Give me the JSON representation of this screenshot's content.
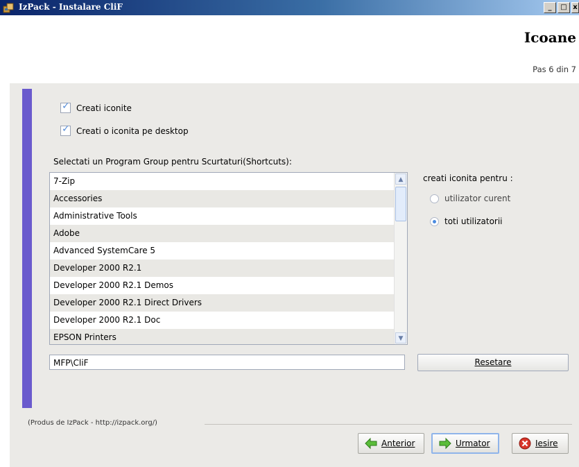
{
  "window": {
    "title": "IzPack - Instalare CliF",
    "buttons": {
      "minimize": "_",
      "maximize": "□",
      "close": "x"
    }
  },
  "header": {
    "heading": "Icoane",
    "step": "Pas 6 din 7"
  },
  "options": {
    "create_icons": {
      "label": "Creati iconite",
      "checked": true
    },
    "create_desktop_icon": {
      "label": "Creati o iconita pe desktop",
      "checked": true
    }
  },
  "program_group": {
    "label": "Selectati un Program Group pentru Scurtaturi(Shortcuts):",
    "items": [
      "7-Zip",
      "Accessories",
      "Administrative Tools",
      "Adobe",
      "Advanced SystemCare 5",
      "Developer 2000 R2.1",
      "Developer 2000 R2.1 Demos",
      "Developer 2000 R2.1 Direct Drivers",
      "Developer 2000 R2.1 Doc",
      "EPSON Printers"
    ],
    "path_value": "MFP\\CliF",
    "reset_label": "Resetare"
  },
  "target": {
    "label": "creati iconita pentru :",
    "options": [
      {
        "label": "utilizator curent",
        "selected": false
      },
      {
        "label": "toti utilizatorii",
        "selected": true
      }
    ]
  },
  "footer": {
    "credit": "(Produs de IzPack - http://izpack.org/)",
    "back_label": "Anterior",
    "next_label": "Urmator",
    "exit_label": "Iesire"
  },
  "colors": {
    "accent": "#6a5acd",
    "titlebar": "#0a246a",
    "panel": "#ebeae7"
  }
}
